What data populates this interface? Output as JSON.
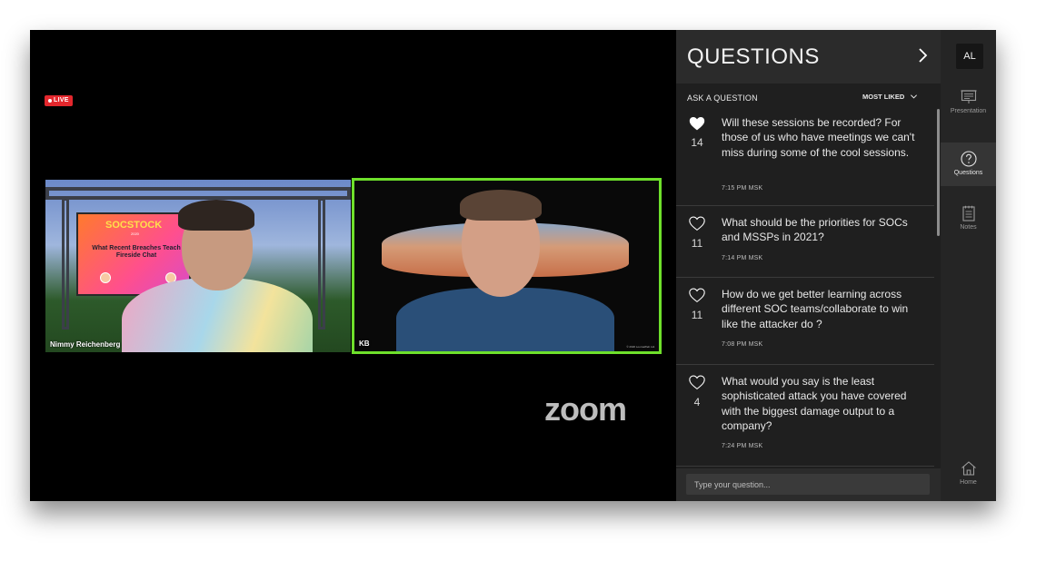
{
  "stage": {
    "live_label": "LIVE",
    "participants": [
      {
        "name": "Nimmy Reichenberg"
      },
      {
        "name": "KB",
        "copyright": "© 2020 LoomaWeb Ltd."
      }
    ],
    "backdrop": {
      "logo": "SOCSTOCK",
      "subtitle": "2020",
      "title": "What Recent Breaches Teach Fireside Chat"
    },
    "watermark": "zoom"
  },
  "questions_panel": {
    "title": "QUESTIONS",
    "ask_label": "ASK A QUESTION",
    "sort_label": "MOST LIKED",
    "input_placeholder": "Type your question...",
    "items": [
      {
        "likes": "14",
        "liked": true,
        "text": "Will these sessions be recorded? For those of us who have meetings we can't miss during some of the cool sessions.",
        "time": "7:15 PM MSK"
      },
      {
        "likes": "11",
        "liked": false,
        "text": "What should be the priorities for SOCs and MSSPs in 2021?",
        "time": "7:14 PM MSK"
      },
      {
        "likes": "11",
        "liked": false,
        "text": "How do we get better learning across different SOC teams/collaborate to win like the attacker do ?",
        "time": "7:08 PM MSK"
      },
      {
        "likes": "4",
        "liked": false,
        "text": "What would you say is the least sophisticated attack you have covered with the biggest damage output to a company?",
        "time": "7:24 PM MSK"
      }
    ]
  },
  "rail": {
    "avatar_initials": "AL",
    "items": [
      {
        "label": "Presentation",
        "icon": "presentation-icon",
        "active": false
      },
      {
        "label": "Questions",
        "icon": "question-circle-icon",
        "active": true
      },
      {
        "label": "Notes",
        "icon": "notes-icon",
        "active": false
      },
      {
        "label": "Home",
        "icon": "home-icon",
        "active": false
      }
    ]
  },
  "colors": {
    "live_badge": "#e3272d",
    "active_speaker_border": "#6ee02b",
    "panel_bg": "#1f1f1f"
  }
}
